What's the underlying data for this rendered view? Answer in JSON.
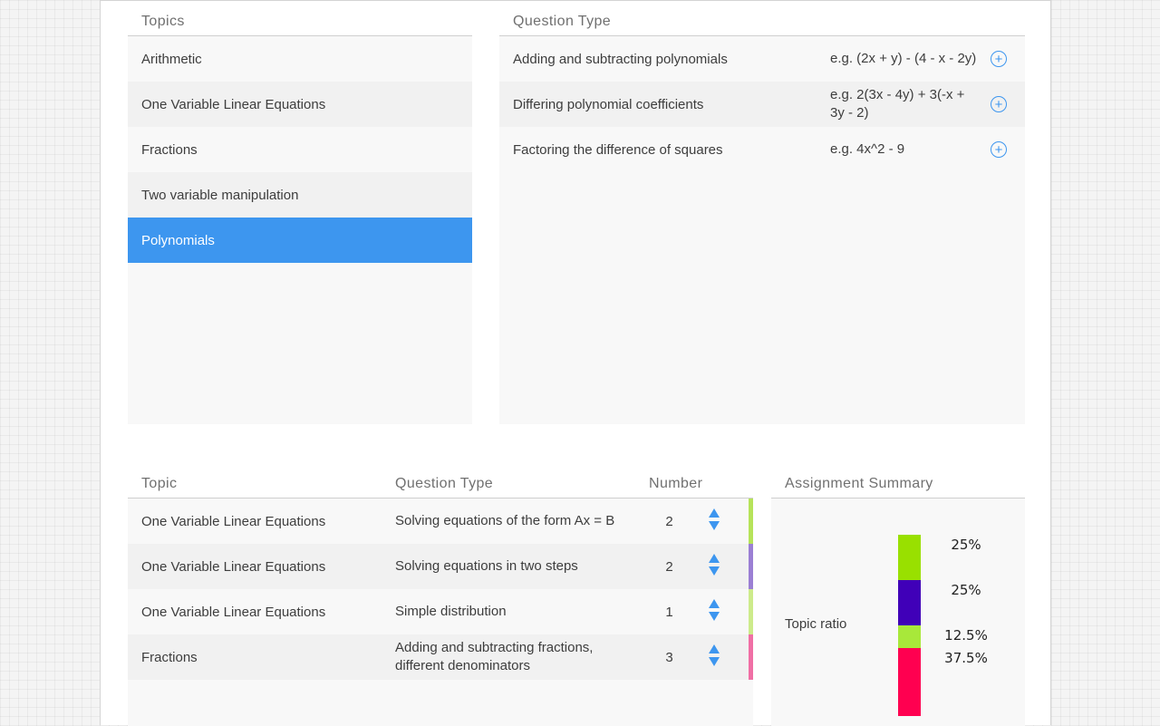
{
  "topics": {
    "header": "Topics",
    "items": [
      {
        "label": "Arithmetic"
      },
      {
        "label": "One Variable Linear Equations"
      },
      {
        "label": "Fractions"
      },
      {
        "label": "Two variable manipulation"
      },
      {
        "label": "Polynomials",
        "selected": true
      }
    ]
  },
  "question_types": {
    "header": "Question Type",
    "items": [
      {
        "name": "Adding and subtracting polynomials",
        "example": "e.g. (2x + y) - (4 - x - 2y)"
      },
      {
        "name": "Differing polynomial coefficients",
        "example": "e.g. 2(3x - 4y) + 3(-x + 3y - 2)"
      },
      {
        "name": "Factoring the difference of squares",
        "example": "e.g. 4x^2 - 9"
      }
    ],
    "add_icon": "plus-circle-icon"
  },
  "assignment": {
    "headers": {
      "topic": "Topic",
      "question_type": "Question Type",
      "number": "Number"
    },
    "rows": [
      {
        "topic": "One Variable Linear Equations",
        "question_type": "Solving equations of the form Ax = B",
        "number": "2",
        "color": "#b6e35a"
      },
      {
        "topic": "One Variable Linear Equations",
        "question_type": "Solving equations in two steps",
        "number": "2",
        "color": "#9b7fd4"
      },
      {
        "topic": "One Variable Linear Equations",
        "question_type": "Simple distribution",
        "number": "1",
        "color": "#cdeb8b"
      },
      {
        "topic": "Fractions",
        "question_type": "Adding and subtracting fractions, different denominators",
        "number": "3",
        "color": "#f06fa5"
      }
    ]
  },
  "summary": {
    "header": "Assignment Summary",
    "label": "Topic ratio",
    "segments": [
      {
        "percent_label": "25%",
        "fraction": 0.25,
        "color": "#99e000"
      },
      {
        "percent_label": "25%",
        "fraction": 0.25,
        "color": "#4000b8"
      },
      {
        "percent_label": "12.5%",
        "fraction": 0.125,
        "color": "#a8e83a"
      },
      {
        "percent_label": "37.5%",
        "fraction": 0.375,
        "color": "#ff0050"
      }
    ]
  }
}
